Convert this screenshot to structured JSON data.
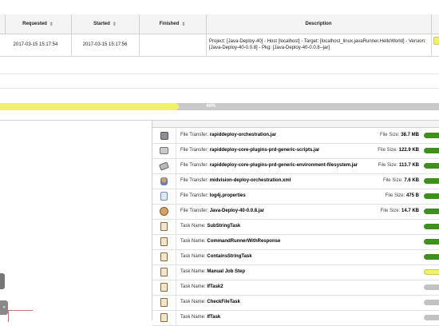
{
  "table": {
    "headers": {
      "requested": "Requested",
      "started": "Started",
      "finished": "Finished",
      "description": "Description"
    },
    "sort_icon": "⇕",
    "row": {
      "requested": "2017-03-15 15:17:54",
      "started": "2017-03-15 15:17:56",
      "finished": "",
      "description_line1": "Project: [Java-Deploy-40] - Host [localhost] - Target: [localhost_linux.javaRunner.HelloWorld] - Version:",
      "description_line2": "[Java-Deploy-40-0.0.8] - Pkg: [Java-Deploy-40-0.0.8--jar]"
    }
  },
  "progress": {
    "label": "46%",
    "value": 0.46,
    "fill_color": "#f2f26a"
  },
  "side_button_label": "»",
  "tasks": [
    {
      "icon": "gear-icon",
      "prefix": "File Transfer:",
      "name": "rapiddeploy-orchestration.jar",
      "size_label": "File Size:",
      "size": "38.7 MB",
      "status": "green"
    },
    {
      "icon": "package-icon",
      "prefix": "File Transfer:",
      "name": "rapiddeploy-core-plugins-prd-generic-scripts.jar",
      "size_label": "File Size:",
      "size": "122.9 KB",
      "status": "green"
    },
    {
      "icon": "plugin-icon",
      "prefix": "File Transfer:",
      "name": "rapiddeploy-core-plugins-prd-generic-environment-filesystem.jar",
      "size_label": "File Size:",
      "size": "113.7 KB",
      "status": "green"
    },
    {
      "icon": "person-icon",
      "prefix": "File Transfer:",
      "name": "midvision-deploy-orchestration.xml",
      "size_label": "File Size:",
      "size": "7.6 KB",
      "status": "green"
    },
    {
      "icon": "document-icon",
      "prefix": "File Transfer:",
      "name": "log4j.properties",
      "size_label": "File Size:",
      "size": "475 B",
      "status": "green"
    },
    {
      "icon": "jar-icon",
      "prefix": "File Transfer:",
      "name": "Java-Deploy-40-0.0.8.jar",
      "size_label": "File Size:",
      "size": "14.7 KB",
      "status": "green"
    },
    {
      "icon": "clipboard-icon",
      "prefix": "Task Name:",
      "name": "SubStringTask",
      "size_label": "",
      "size": "",
      "status": "green"
    },
    {
      "icon": "clipboard-icon",
      "prefix": "Task Name:",
      "name": "CommandRunnerWithResponse",
      "size_label": "",
      "size": "",
      "status": "green"
    },
    {
      "icon": "clipboard-icon",
      "prefix": "Task Name:",
      "name": "ContainsStringTask",
      "size_label": "",
      "size": "",
      "status": "green"
    },
    {
      "icon": "clipboard-icon",
      "prefix": "Task Name:",
      "name": "Manual Job Step",
      "size_label": "",
      "size": "",
      "status": "yellow"
    },
    {
      "icon": "clipboard-icon",
      "prefix": "Task Name:",
      "name": "IfTask2",
      "size_label": "",
      "size": "",
      "status": "grey"
    },
    {
      "icon": "clipboard-icon",
      "prefix": "Task Name:",
      "name": "CheckFileTask",
      "size_label": "",
      "size": "",
      "status": "grey"
    },
    {
      "icon": "clipboard-icon",
      "prefix": "Task Name:",
      "name": "IfTask",
      "size_label": "",
      "size": "",
      "status": "grey"
    }
  ],
  "colors": {
    "green": "#3f8f1e",
    "yellow": "#f2f26a",
    "grey": "#c2c2c2"
  }
}
